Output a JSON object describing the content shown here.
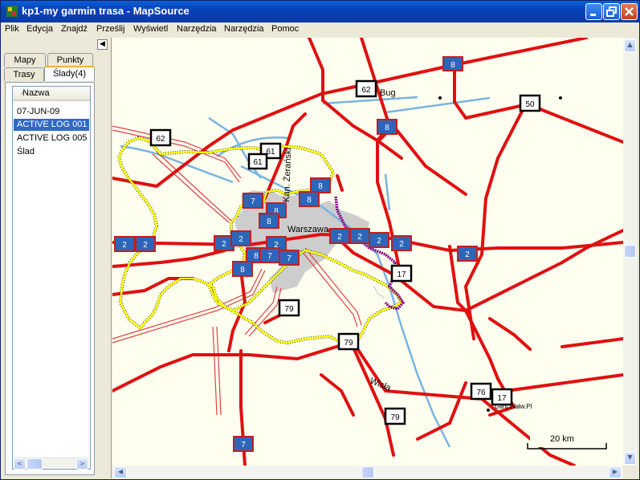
{
  "window": {
    "title": "kp1-my garmin trasa - MapSource",
    "colors": {
      "titlebar": "#0a3fb0",
      "selection": "#316ac5",
      "road": "#e01010",
      "river": "#78b4e0",
      "track_yellow": "#ffff00",
      "track_purple": "#800080",
      "city": "#cdcdcd"
    }
  },
  "menu": [
    "Plik",
    "Edycja",
    "Znajdź",
    "Prześlij",
    "Wyświetl",
    "Narzędzia",
    "Narzędzia",
    "Pomoc"
  ],
  "panel": {
    "tabs": {
      "maps": "Mapy",
      "points": "Punkty",
      "routes": "Trasy",
      "tracks": "Ślady(4)"
    },
    "column_header": "Nazwa",
    "tracks": [
      "07-JUN-09",
      "ACTIVE LOG 001",
      "ACTIVE LOG 005",
      "Ślad"
    ],
    "selected_track": "ACTIVE LOG 001"
  },
  "map": {
    "labels": {
      "city": "Warszawa",
      "river_bug": "Bug",
      "river_wisla": "Wisła",
      "canal": "Kan. Żerański",
      "place": "Glinj.Wałw.Pl",
      "scale": "20 km"
    },
    "shields": {
      "s8a": "8",
      "s62a": "62",
      "s50": "50",
      "s8b": "8",
      "s62b": "62",
      "s61a": "61",
      "s61b": "61",
      "s7a": "7",
      "s8c": "8",
      "s8d": "8",
      "s8e": "8",
      "s8f": "8",
      "s2a": "2",
      "s2b": "2",
      "s2c": "2",
      "s2d": "2",
      "s2e": "2",
      "s8g": "8",
      "s7b": "7",
      "s8h": "8",
      "s7c": "7",
      "s2f": "2",
      "s2g": "2",
      "s2h": "2",
      "s2i": "2",
      "s2j": "2",
      "s17a": "17",
      "s79a": "79",
      "s79b": "79",
      "s76": "76",
      "s17b": "17",
      "s79c": "79",
      "s7d": "7"
    }
  }
}
